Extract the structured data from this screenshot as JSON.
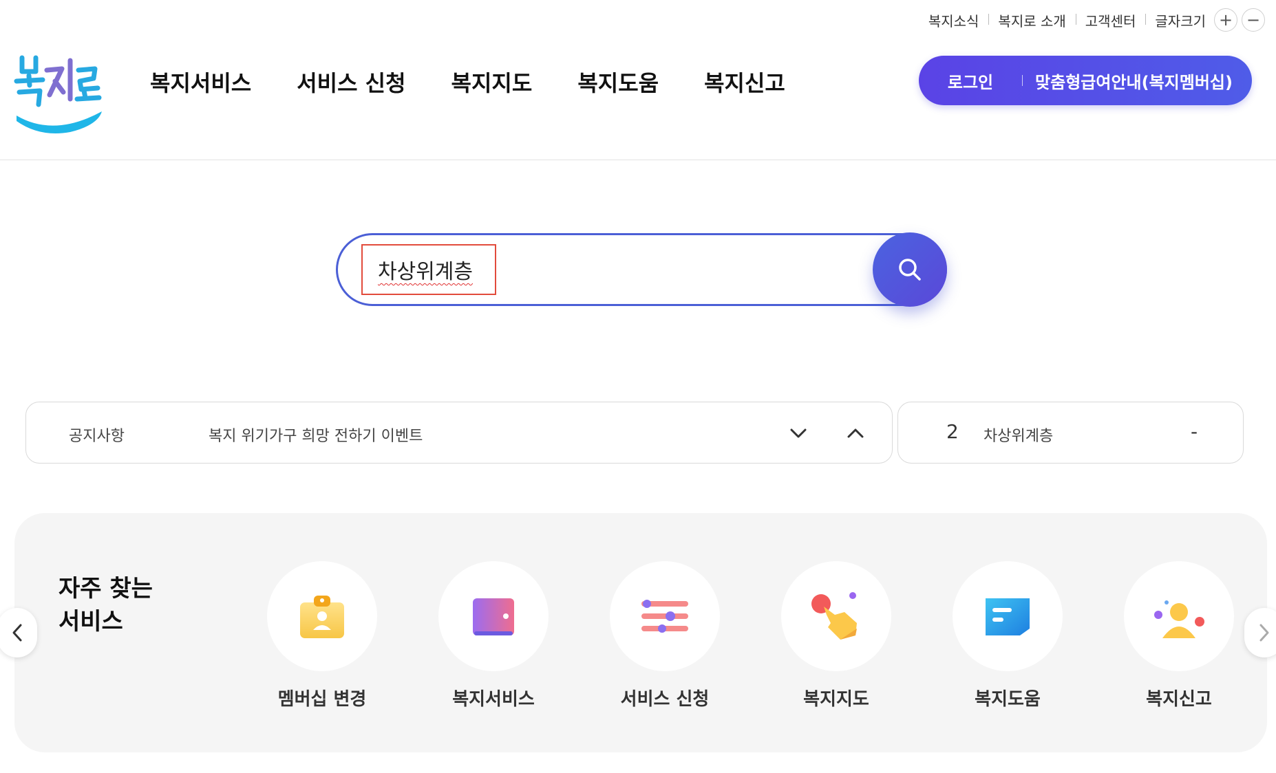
{
  "utility": {
    "links": [
      "복지소식",
      "복지로 소개",
      "고객센터"
    ],
    "font_size_label": "글자크기",
    "increase": "+",
    "decrease": "−"
  },
  "logo": {
    "text": "복지로",
    "colors": {
      "primary": "#27a9e1",
      "accent": "#1fb6e8"
    }
  },
  "gnb": [
    "복지서비스",
    "서비스 신청",
    "복지지도",
    "복지도움",
    "복지신고"
  ],
  "member": {
    "login": "로그인",
    "guide": "맞춤형급여안내(복지멤버십)",
    "color": "#5a43e6"
  },
  "search": {
    "value": "차상위계층",
    "icon": "search-icon",
    "color": "#4b5fd6"
  },
  "notice": {
    "label": "공지사항",
    "text": "복지 위기가구 희망 전하기 이벤트",
    "prev_icon": "chevron-down-icon",
    "next_icon": "chevron-up-icon"
  },
  "ranking": {
    "rank": "2",
    "keyword": "차상위계층",
    "change": "-"
  },
  "favorites": {
    "title_line1": "자주 찾는",
    "title_line2": "서비스",
    "items": [
      {
        "label": "멤버십 변경",
        "icon": "id-badge-icon"
      },
      {
        "label": "복지서비스",
        "icon": "wallet-icon"
      },
      {
        "label": "서비스 신청",
        "icon": "sliders-icon"
      },
      {
        "label": "복지지도",
        "icon": "hand-pointer-icon"
      },
      {
        "label": "복지도움",
        "icon": "chat-card-icon"
      },
      {
        "label": "복지신고",
        "icon": "person-icon"
      }
    ]
  }
}
